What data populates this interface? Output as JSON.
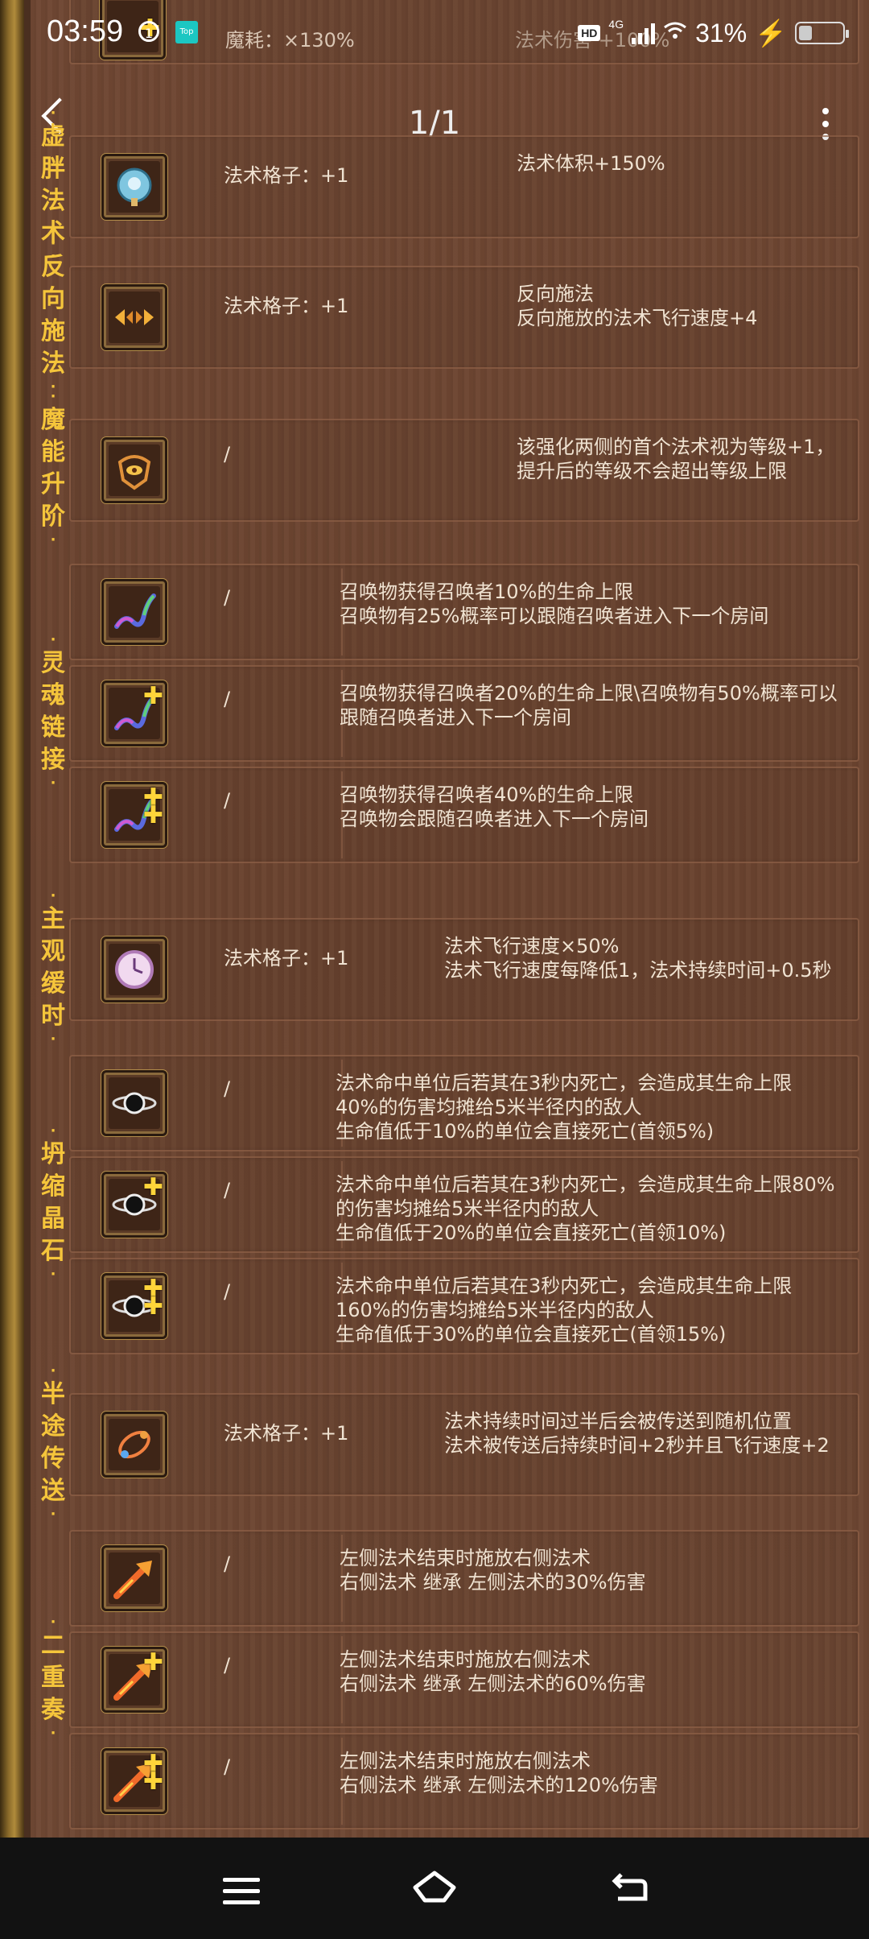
{
  "status_bar": {
    "time": "03:59",
    "notif_icon_text": "1",
    "app_badge": "Top",
    "network_badge": "HD",
    "network_type": "4G",
    "battery_percent": "31%",
    "battery_level": 0.31
  },
  "header": {
    "page_indicator": "1/1",
    "partial_row_cost": "魔耗：×130%",
    "partial_row_desc": "法术伤害 +100%"
  },
  "groups": [
    {
      "name": "虚胖法术",
      "rows": [
        {
          "icon": "bubble-icon",
          "plus": 0,
          "slot": "法术格子：+1",
          "desc": "法术体积+150%"
        }
      ]
    },
    {
      "name": "反向施法",
      "rows": [
        {
          "icon": "reverse-arrows-icon",
          "plus": 0,
          "slot": "法术格子：+1",
          "desc": "反向施法\n反向施放的法术飞行速度+4"
        }
      ]
    },
    {
      "name": "魔能升阶",
      "rows": [
        {
          "icon": "eye-totem-icon",
          "plus": 0,
          "slot": "/",
          "desc": "该强化两侧的首个法术视为等级+1，\n提升后的等级不会超出等级上限"
        }
      ]
    },
    {
      "name": "灵魂链接",
      "rows": [
        {
          "icon": "soul-chain-icon",
          "plus": 0,
          "slot": "/",
          "desc": "召唤物获得召唤者10%的生命上限\n召唤物有25%概率可以跟随召唤者进入下一个房间"
        },
        {
          "icon": "soul-chain-icon",
          "plus": 1,
          "slot": "/",
          "desc": "召唤物获得召唤者20%的生命上限\\召唤物有50%概率可以\n跟随召唤者进入下一个房间"
        },
        {
          "icon": "soul-chain-icon",
          "plus": 2,
          "slot": "/",
          "desc": "召唤物获得召唤者40%的生命上限\n召唤物会跟随召唤者进入下一个房间"
        }
      ]
    },
    {
      "name": "主观缓时",
      "rows": [
        {
          "icon": "clock-icon",
          "plus": 0,
          "slot": "法术格子：+1",
          "desc": "法术飞行速度×50%\n法术飞行速度每降低1，法术持续时间+0.5秒"
        }
      ]
    },
    {
      "name": "坍缩晶石",
      "rows": [
        {
          "icon": "black-hole-icon",
          "plus": 0,
          "slot": "/",
          "desc": "法术命中单位后若其在3秒内死亡，会造成其生命上限\n40%的伤害均摊给5米半径内的敌人\n生命值低于10%的单位会直接死亡(首领5%)"
        },
        {
          "icon": "black-hole-icon",
          "plus": 1,
          "slot": "/",
          "desc": "法术命中单位后若其在3秒内死亡，会造成其生命上限80%\n的伤害均摊给5米半径内的敌人\n生命值低于20%的单位会直接死亡(首领10%)"
        },
        {
          "icon": "black-hole-icon",
          "plus": 2,
          "slot": "/",
          "desc": "法术命中单位后若其在3秒内死亡，会造成其生命上限\n160%的伤害均摊给5米半径内的敌人\n生命值低于30%的单位会直接死亡(首领15%)"
        }
      ]
    },
    {
      "name": "半途传送",
      "rows": [
        {
          "icon": "teleport-orbit-icon",
          "plus": 0,
          "slot": "法术格子：+1",
          "desc": "法术持续时间过半后会被传送到随机位置\n法术被传送后持续时间+2秒并且飞行速度+2"
        }
      ]
    },
    {
      "name": "二重奏",
      "rows": [
        {
          "icon": "fire-arrow-icon",
          "plus": 0,
          "slot": "/",
          "desc": "左侧法术结束时施放右侧法术\n右侧法术 继承 左侧法术的30%伤害"
        },
        {
          "icon": "fire-arrow-icon",
          "plus": 1,
          "slot": "/",
          "desc": "左侧法术结束时施放右侧法术\n右侧法术 继承 左侧法术的60%伤害"
        },
        {
          "icon": "fire-arrow-icon",
          "plus": 2,
          "slot": "/",
          "desc": "左侧法术结束时施放右侧法术\n右侧法术 继承 左侧法术的120%伤害"
        }
      ]
    }
  ]
}
